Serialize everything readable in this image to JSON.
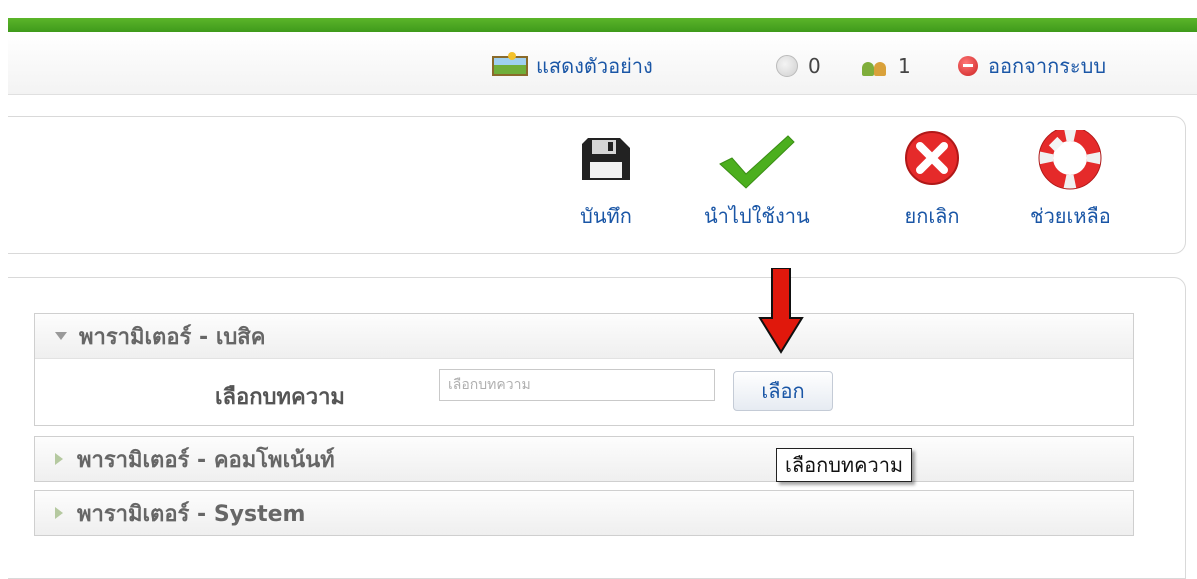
{
  "status": {
    "preview_label": "แสดงตัวอย่าง",
    "messages_count": "0",
    "users_count": "1",
    "logout_label": "ออกจากระบบ"
  },
  "toolbar": {
    "save_label": "บันทึก",
    "apply_label": "นำไปใช้งาน",
    "cancel_label": "ยกเลิก",
    "help_label": "ช่วยเหลือ"
  },
  "panels": {
    "basic_title": "พารามิเตอร์ - เบสิค",
    "article_field_label": "เลือกบทความ",
    "article_input_placeholder": "เลือกบทความ",
    "select_button_label": "เลือก",
    "component_title": "พารามิเตอร์ - คอมโพเน้นท์",
    "system_title": "พารามิเตอร์ - System"
  },
  "tooltip": {
    "text": "เลือกบทความ"
  },
  "colors": {
    "accent_green": "#4caf1e",
    "link_blue": "#1a56a6",
    "arrow_red": "#e0180c"
  }
}
